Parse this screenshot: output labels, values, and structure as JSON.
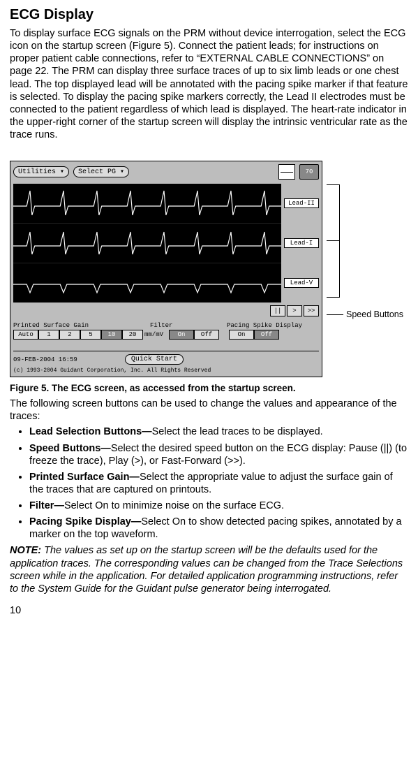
{
  "heading": "ECG Display",
  "body_paragraph": "To display surface ECG signals on the PRM without device interrogation, select the ECG icon on the startup screen (Figure 5). Connect the patient leads; for instructions on proper patient cable connections, refer to “EXTERNAL CABLE CONNECTIONS” on page 22. The PRM can display three surface traces of up to six limb leads or one chest lead. The top displayed lead will be annotated with the pacing spike marker if that feature is selected. To display the pacing spike markers correctly, the Lead II electrodes must be connected to the patient regardless of which lead is displayed. The heart-rate indicator in the upper-right corner of the startup screen will display the intrinsic ventricular rate as the trace runs.",
  "screenshot": {
    "toolbar": {
      "utilities": "Utilities ▾",
      "select_pg": "Select PG ▾",
      "heart_rate": "70"
    },
    "leads": [
      "Lead-II",
      "Lead-I",
      "Lead-V"
    ],
    "speed": {
      "pause": "||",
      "play": ">",
      "fast": ">>"
    },
    "controls": {
      "gain_label": "Printed Surface Gain",
      "filter_label": "Filter",
      "spike_label": "Pacing Spike Display",
      "gain_values": [
        "Auto",
        "1",
        "2",
        "5",
        "10",
        "20"
      ],
      "gain_selected_index": 4,
      "gain_unit": "mm/mV",
      "filter_values": [
        "On",
        "Off"
      ],
      "filter_selected_index": 0,
      "spike_values": [
        "On",
        "Off"
      ],
      "spike_selected_index": 1
    },
    "timestamp": "09-FEB-2004 16:59",
    "quick_start": "Quick Start",
    "copyright": "(c) 1993-2004 Guidant Corporation, Inc. All Rights Reserved"
  },
  "callout_speed": "Speed Buttons",
  "figcaption": "Figure 5. The ECG screen, as accessed from the startup screen.",
  "intro_after": "The following screen buttons can be used to change the values and appearance of the traces:",
  "bullets": [
    {
      "title": "Lead Selection Buttons—",
      "text": "Select the lead traces to be displayed."
    },
    {
      "title": "Speed Buttons—",
      "text": "Select the desired speed button on the ECG display: Pause (||) (to freeze the trace), Play (>), or Fast-Forward (>>)."
    },
    {
      "title": "Printed Surface Gain—",
      "text": "Select the appropriate value to adjust the surface gain of the traces that are captured on printouts."
    },
    {
      "title": "Filter—",
      "text": "Select On to minimize noise on the surface ECG."
    },
    {
      "title": "Pacing Spike Display—",
      "text": "Select On to show detected pacing spikes, annotated by a marker on the top waveform."
    }
  ],
  "note_label": "NOTE:",
  "note_text": "The values as set up on the startup screen will be the defaults used for the application traces. The corresponding values can be changed from the Trace Selections screen while in the application. For detailed application programming instructions, refer to the System Guide for the Guidant pulse generator being interrogated.",
  "page_number": "10"
}
